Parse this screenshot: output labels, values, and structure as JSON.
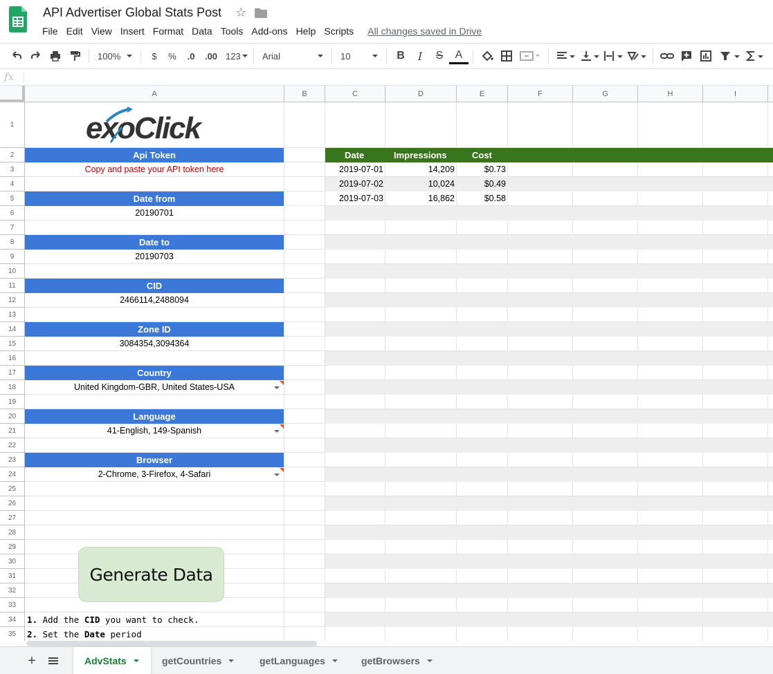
{
  "app": {
    "doc_title": "API Advertiser Global Stats Post",
    "save_status": "All changes saved in Drive",
    "menu": [
      "File",
      "Edit",
      "View",
      "Insert",
      "Format",
      "Data",
      "Tools",
      "Add-ons",
      "Help",
      "Scripts"
    ]
  },
  "toolbar": {
    "zoom": "100%",
    "currency": "$",
    "percent": "%",
    "dec_decrease": ".0",
    "dec_increase": ".00",
    "more_formats": "123",
    "font": "Arial",
    "font_size": "10",
    "bold": "B",
    "italic": "I",
    "strike": "S",
    "text_color": "A"
  },
  "formula": {
    "fx": "fx",
    "value": ""
  },
  "columns": [
    "A",
    "B",
    "C",
    "D",
    "E",
    "F",
    "G",
    "H",
    "I"
  ],
  "rows": [
    "1",
    "2",
    "3",
    "4",
    "5",
    "6",
    "7",
    "8",
    "9",
    "10",
    "11",
    "12",
    "13",
    "14",
    "15",
    "16",
    "17",
    "18",
    "19",
    "20",
    "21",
    "22",
    "23",
    "24",
    "25",
    "26",
    "27",
    "28",
    "29",
    "30",
    "31",
    "32",
    "33",
    "34",
    "35"
  ],
  "form": {
    "logo": "exoClick",
    "api_token_label": "Api Token",
    "api_token_hint": "Copy and paste your API token here",
    "date_from_label": "Date from",
    "date_from": "20190701",
    "date_to_label": "Date to",
    "date_to": "20190703",
    "cid_label": "CID",
    "cid": "2466114,2488094",
    "zone_label": "Zone ID",
    "zone": "3084354,3094364",
    "country_label": "Country",
    "country": "United Kingdom-GBR, United States-USA",
    "language_label": "Language",
    "language": "41-English, 149-Spanish",
    "browser_label": "Browser",
    "browser": "2-Chrome, 3-Firefox, 4-Safari",
    "generate_button": "Generate Data",
    "instr1_num": "1.",
    "instr1_pre": "Add the",
    "instr1_bold": "CID",
    "instr1_post": "you want to check.",
    "instr2_num": "2.",
    "instr2_pre": "Set the",
    "instr2_bold": "Date",
    "instr2_post": "period"
  },
  "results": {
    "headers": {
      "date": "Date",
      "impressions": "Impressions",
      "cost": "Cost"
    },
    "rows": [
      {
        "date": "2019-07-01",
        "impressions": "14,209",
        "cost": "$0.73"
      },
      {
        "date": "2019-07-02",
        "impressions": "10,024",
        "cost": "$0.49"
      },
      {
        "date": "2019-07-03",
        "impressions": "16,862",
        "cost": "$0.58"
      }
    ]
  },
  "tabs": [
    "AdvStats",
    "getCountries",
    "getLanguages",
    "getBrowsers"
  ],
  "colors": {
    "header_blue": "#3c78d8",
    "header_green": "#38761d",
    "button_green": "#d9ead3",
    "hint_red": "#cc0000",
    "active_tab": "#188038"
  }
}
